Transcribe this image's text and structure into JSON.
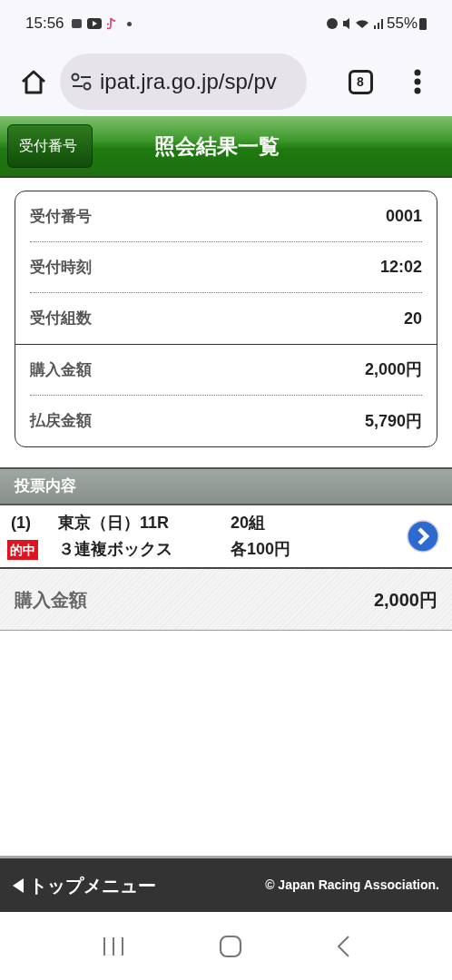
{
  "status_bar": {
    "time": "15:56",
    "battery": "55%"
  },
  "browser": {
    "url": "ipat.jra.go.jp/sp/pv",
    "tab_count": "8"
  },
  "header": {
    "back_button": "受付番号",
    "title": "照会結果一覧"
  },
  "summary": {
    "rows": [
      {
        "label": "受付番号",
        "value": "0001"
      },
      {
        "label": "受付時刻",
        "value": "12:02"
      },
      {
        "label": "受付組数",
        "value": "20"
      }
    ],
    "totals": [
      {
        "label": "購入金額",
        "value": "2,000円"
      },
      {
        "label": "払戻金額",
        "value": "5,790円"
      }
    ]
  },
  "section": {
    "title": "投票内容"
  },
  "bets": [
    {
      "index": "(1)",
      "race": "東京（日）11R",
      "count": "20組",
      "badge": "的中",
      "type": "３連複ボックス",
      "unit": "各100円"
    }
  ],
  "purchase_total": {
    "label": "購入金額",
    "value": "2,000円"
  },
  "footer": {
    "link": "トップメニュー",
    "copyright": "© Japan Racing Association."
  }
}
